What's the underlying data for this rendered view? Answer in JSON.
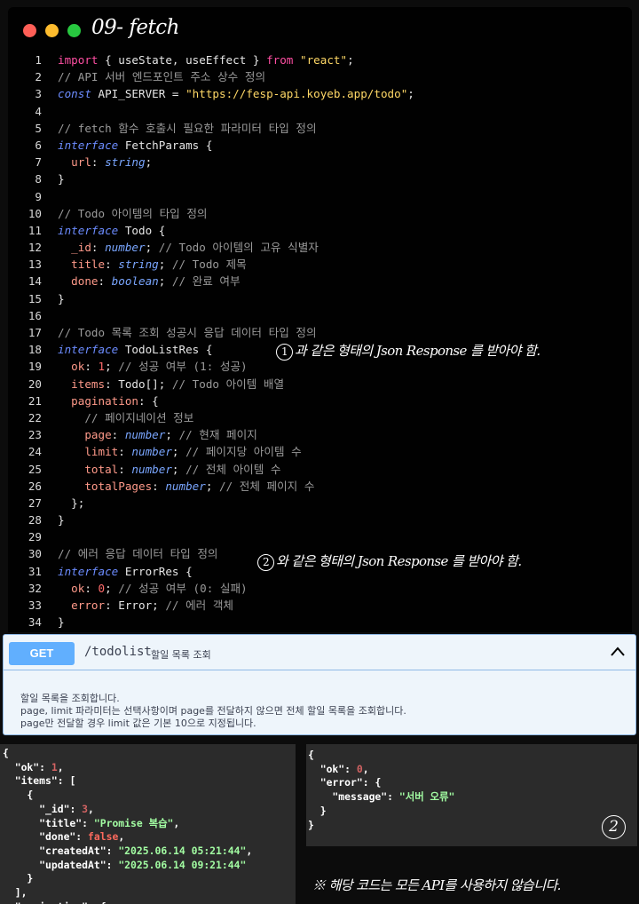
{
  "editor": {
    "title": "09- fetch",
    "annotation_1": "과 같은 형태의 Json Response 를 받아야 함.",
    "annotation_1_num": "1",
    "annotation_2": "와 같은 형태의 Json Response 를 받아야 함.",
    "annotation_2_num": "2",
    "lines": [
      [
        [
          "import",
          "kw"
        ],
        [
          " { useState, useEffect } ",
          "pl"
        ],
        [
          "from",
          "kw"
        ],
        [
          " ",
          "pl"
        ],
        [
          "\"react\"",
          "str"
        ],
        [
          ";",
          "pl"
        ]
      ],
      [
        [
          "// API 서버 엔드포인트 주소 상수 정의",
          "cmt"
        ]
      ],
      [
        [
          "const",
          "kwi"
        ],
        [
          " API_SERVER = ",
          "pl"
        ],
        [
          "\"https://fesp-api.koyeb.app/todo\"",
          "str"
        ],
        [
          ";",
          "pl"
        ]
      ],
      [],
      [
        [
          "// fetch 함수 호출시 필요한 파라미터 타입 정의",
          "cmt"
        ]
      ],
      [
        [
          "interface",
          "kwi"
        ],
        [
          " FetchParams {",
          "pl"
        ]
      ],
      [
        [
          "  url",
          "prop"
        ],
        [
          ": ",
          "pl"
        ],
        [
          "string",
          "ty"
        ],
        [
          ";",
          "pl"
        ]
      ],
      [
        [
          "}",
          "pl"
        ]
      ],
      [],
      [
        [
          "// Todo 아이템의 타입 정의",
          "cmt"
        ]
      ],
      [
        [
          "interface",
          "kwi"
        ],
        [
          " Todo {",
          "pl"
        ]
      ],
      [
        [
          "  _id",
          "prop"
        ],
        [
          ": ",
          "pl"
        ],
        [
          "number",
          "ty"
        ],
        [
          "; ",
          "pl"
        ],
        [
          "// Todo 아이템의 고유 식별자",
          "cmt"
        ]
      ],
      [
        [
          "  title",
          "prop"
        ],
        [
          ": ",
          "pl"
        ],
        [
          "string",
          "ty"
        ],
        [
          "; ",
          "pl"
        ],
        [
          "// Todo 제목",
          "cmt"
        ]
      ],
      [
        [
          "  done",
          "prop"
        ],
        [
          ": ",
          "pl"
        ],
        [
          "boolean",
          "ty"
        ],
        [
          "; ",
          "pl"
        ],
        [
          "// 완료 여부",
          "cmt"
        ]
      ],
      [
        [
          "}",
          "pl"
        ]
      ],
      [],
      [
        [
          "// Todo 목록 조회 성공시 응답 데이터 타입 정의",
          "cmt"
        ]
      ],
      [
        [
          "interface",
          "kwi"
        ],
        [
          " TodoListRes {",
          "pl"
        ]
      ],
      [
        [
          "  ok",
          "prop"
        ],
        [
          ": ",
          "pl"
        ],
        [
          "1",
          "num"
        ],
        [
          "; ",
          "pl"
        ],
        [
          "// 성공 여부 (1: 성공)",
          "cmt"
        ]
      ],
      [
        [
          "  items",
          "prop"
        ],
        [
          ": Todo[]; ",
          "pl"
        ],
        [
          "// Todo 아이템 배열",
          "cmt"
        ]
      ],
      [
        [
          "  pagination",
          "prop"
        ],
        [
          ": {",
          "pl"
        ]
      ],
      [
        [
          "    // 페이지네이션 정보",
          "cmt"
        ]
      ],
      [
        [
          "    page",
          "prop"
        ],
        [
          ": ",
          "pl"
        ],
        [
          "number",
          "ty"
        ],
        [
          "; ",
          "pl"
        ],
        [
          "// 현재 페이지",
          "cmt"
        ]
      ],
      [
        [
          "    limit",
          "prop"
        ],
        [
          ": ",
          "pl"
        ],
        [
          "number",
          "ty"
        ],
        [
          "; ",
          "pl"
        ],
        [
          "// 페이지당 아이템 수",
          "cmt"
        ]
      ],
      [
        [
          "    total",
          "prop"
        ],
        [
          ": ",
          "pl"
        ],
        [
          "number",
          "ty"
        ],
        [
          "; ",
          "pl"
        ],
        [
          "// 전체 아이템 수",
          "cmt"
        ]
      ],
      [
        [
          "    totalPages",
          "prop"
        ],
        [
          ": ",
          "pl"
        ],
        [
          "number",
          "ty"
        ],
        [
          "; ",
          "pl"
        ],
        [
          "// 전체 페이지 수",
          "cmt"
        ]
      ],
      [
        [
          "  };",
          "pl"
        ]
      ],
      [
        [
          "}",
          "pl"
        ]
      ],
      [],
      [
        [
          "// 에러 응답 데이터 타입 정의",
          "cmt"
        ]
      ],
      [
        [
          "interface",
          "kwi"
        ],
        [
          " ErrorRes {",
          "pl"
        ]
      ],
      [
        [
          "  ok",
          "prop"
        ],
        [
          ": ",
          "pl"
        ],
        [
          "0",
          "num"
        ],
        [
          "; ",
          "pl"
        ],
        [
          "// 성공 여부 (0: 실패)",
          "cmt"
        ]
      ],
      [
        [
          "  error",
          "prop"
        ],
        [
          ": Error; ",
          "pl"
        ],
        [
          "// 에러 객체",
          "cmt"
        ]
      ],
      [
        [
          "}",
          "pl"
        ]
      ]
    ]
  },
  "swagger": {
    "method": "GET",
    "path": "/todolist",
    "summary": "할일 목록 조회",
    "description": [
      "할일 목록을 조회합니다.",
      "page, limit 파라미터는 선택사항이며 page를 전달하지 않으면 전체 할일 목록을 조회합니다.",
      "page만 전달할 경우 limit 값은 기본 10으로 지정됩니다."
    ]
  },
  "json_left": [
    [
      [
        "{",
        "p"
      ]
    ],
    [
      [
        "  \"ok\"",
        "k"
      ],
      [
        ": ",
        "p"
      ],
      [
        "1",
        "n"
      ],
      [
        ",",
        "p"
      ]
    ],
    [
      [
        "  \"items\"",
        "k"
      ],
      [
        ": [",
        "p"
      ]
    ],
    [
      [
        "    {",
        "p"
      ]
    ],
    [
      [
        "      \"_id\"",
        "k"
      ],
      [
        ": ",
        "p"
      ],
      [
        "3",
        "n"
      ],
      [
        ",",
        "p"
      ]
    ],
    [
      [
        "      \"title\"",
        "k"
      ],
      [
        ": ",
        "p"
      ],
      [
        "\"Promise 복습\"",
        "s"
      ],
      [
        ",",
        "p"
      ]
    ],
    [
      [
        "      \"done\"",
        "k"
      ],
      [
        ": ",
        "p"
      ],
      [
        "false",
        "b"
      ],
      [
        ",",
        "p"
      ]
    ],
    [
      [
        "      \"createdAt\"",
        "k"
      ],
      [
        ": ",
        "p"
      ],
      [
        "\"2025.06.14 05:21:44\"",
        "s"
      ],
      [
        ",",
        "p"
      ]
    ],
    [
      [
        "      \"updatedAt\"",
        "k"
      ],
      [
        ": ",
        "p"
      ],
      [
        "\"2025.06.14 09:21:44\"",
        "s"
      ]
    ],
    [
      [
        "    }",
        "p"
      ]
    ],
    [
      [
        "  ],",
        "p"
      ]
    ],
    [
      [
        "  \"pagination\"",
        "k"
      ],
      [
        ": {",
        "p"
      ]
    ]
  ],
  "json_right": [
    [
      [
        "{",
        "p"
      ]
    ],
    [
      [
        "  \"ok\"",
        "k"
      ],
      [
        ": ",
        "p"
      ],
      [
        "0",
        "n"
      ],
      [
        ",",
        "p"
      ]
    ],
    [
      [
        "  \"error\"",
        "k"
      ],
      [
        ": {",
        "p"
      ]
    ],
    [
      [
        "    \"message\"",
        "k"
      ],
      [
        ": ",
        "p"
      ],
      [
        "\"서버 오류\"",
        "s"
      ]
    ],
    [
      [
        "  }",
        "p"
      ]
    ],
    [
      [
        "}",
        "p"
      ]
    ]
  ],
  "right_marker": "2",
  "note": "※ 해당 코드는 모든 API를 사용하지 않습니다.",
  "note_sub": "ㅡ   ㅡ"
}
